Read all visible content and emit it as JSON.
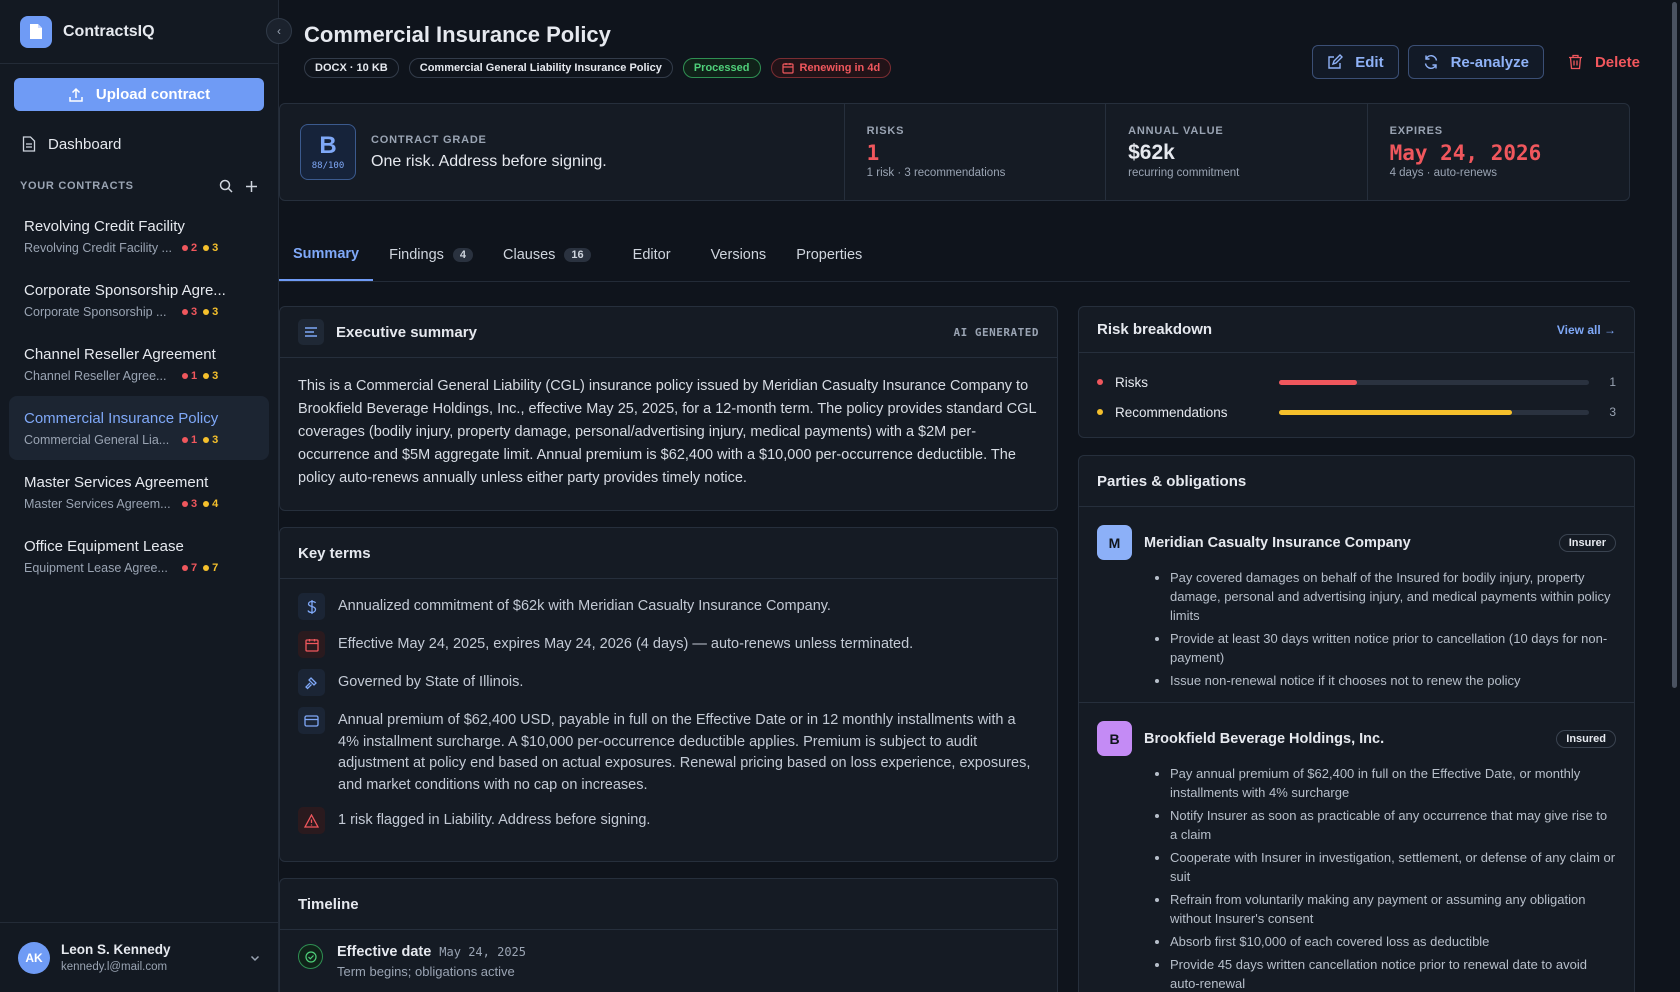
{
  "app": {
    "name": "ContractsIQ",
    "upload_label": "Upload contract",
    "dashboard_label": "Dashboard"
  },
  "sidebar": {
    "section_title": "YOUR CONTRACTS",
    "contracts": [
      {
        "title": "Revolving Credit Facility",
        "subtitle": "Revolving Credit Facility ...",
        "risks": "2",
        "recs": "3"
      },
      {
        "title": "Corporate Sponsorship Agre...",
        "subtitle": "Corporate Sponsorship ...",
        "risks": "3",
        "recs": "3"
      },
      {
        "title": "Channel Reseller Agreement",
        "subtitle": "Channel Reseller Agree...",
        "risks": "1",
        "recs": "3"
      },
      {
        "title": "Commercial Insurance Policy",
        "subtitle": "Commercial General Lia...",
        "risks": "1",
        "recs": "3"
      },
      {
        "title": "Master Services Agreement",
        "subtitle": "Master Services Agreem...",
        "risks": "3",
        "recs": "4"
      },
      {
        "title": "Office Equipment Lease",
        "subtitle": "Equipment Lease Agree...",
        "risks": "7",
        "recs": "7"
      }
    ]
  },
  "user": {
    "initials": "AK",
    "name": "Leon S. Kennedy",
    "email": "kennedy.l@mail.com"
  },
  "header": {
    "title": "Commercial Insurance Policy",
    "chips": {
      "file": "DOCX · 10 KB",
      "type": "Commercial General Liability Insurance Policy",
      "status": "Processed",
      "renewal": "Renewing in 4d"
    },
    "edit_label": "Edit",
    "reanalyze_label": "Re-analyze",
    "delete_label": "Delete"
  },
  "grade": {
    "letter": "B",
    "score": "88/100",
    "label": "CONTRACT GRADE",
    "message": "One risk. Address before signing."
  },
  "stats": [
    {
      "label": "RISKS",
      "value": "1",
      "sub": "1 risk · 3 recommendations"
    },
    {
      "label": "ANNUAL VALUE",
      "value": "$62k",
      "sub": "recurring commitment"
    },
    {
      "label": "EXPIRES",
      "value": "May 24, 2026",
      "sub": "4 days · auto-renews"
    }
  ],
  "tabs": [
    {
      "label": "Summary"
    },
    {
      "label": "Findings",
      "badge": "4"
    },
    {
      "label": "Clauses",
      "badge": "16"
    },
    {
      "label": "Editor"
    },
    {
      "label": "Versions"
    },
    {
      "label": "Properties"
    }
  ],
  "exec_summary": {
    "title": "Executive summary",
    "tag": "AI GENERATED",
    "text": "This is a Commercial General Liability (CGL) insurance policy issued by Meridian Casualty Insurance Company to Brookfield Beverage Holdings, Inc., effective May 25, 2025, for a 12-month term. The policy provides standard CGL coverages (bodily injury, property damage, personal/advertising injury, medical payments) with a $2M per-occurrence and $5M aggregate limit. Annual premium is $62,400 with a $10,000 per-occurrence deductible. The policy auto-renews annually unless either party provides timely notice."
  },
  "key_terms": {
    "title": "Key terms",
    "items": [
      {
        "icon": "dollar-icon",
        "text": "Annualized commitment of $62k with Meridian Casualty Insurance Company."
      },
      {
        "icon": "calendar-icon",
        "text": "Effective May 24, 2025, expires May 24, 2026 (4 days) — auto-renews unless terminated."
      },
      {
        "icon": "gavel-icon",
        "text": "Governed by State of Illinois."
      },
      {
        "icon": "credit-card-icon",
        "text": "Annual premium of $62,400 USD, payable in full on the Effective Date or in 12 monthly installments with a 4% installment surcharge. A $10,000 per-occurrence deductible applies. Premium is subject to audit adjustment at policy end based on actual exposures. Renewal pricing based on loss experience, exposures, and market conditions with no cap on increases."
      },
      {
        "icon": "warning-icon",
        "text": "1 risk flagged in Liability. Address before signing."
      }
    ]
  },
  "timeline": {
    "title": "Timeline",
    "items": [
      {
        "title": "Effective date",
        "date": "May 24, 2025",
        "sub": "Term begins; obligations active"
      }
    ]
  },
  "risk_breakdown": {
    "title": "Risk breakdown",
    "view_all": "View all →",
    "rows": [
      {
        "label": "Risks",
        "count": "1",
        "fraction": 0.25,
        "color": "#f0575d"
      },
      {
        "label": "Recommendations",
        "count": "3",
        "fraction": 0.75,
        "color": "#f5c02c"
      }
    ]
  },
  "parties": {
    "title": "Parties & obligations",
    "items": [
      {
        "initial": "M",
        "name": "Meridian Casualty Insurance Company",
        "role": "Insurer",
        "color": "#8cb0f8",
        "obligations": [
          "Pay covered damages on behalf of the Insured for bodily injury, property damage, personal and advertising injury, and medical payments within policy limits",
          "Provide at least 30 days written notice prior to cancellation (10 days for non-payment)",
          "Issue non-renewal notice if it chooses not to renew the policy"
        ]
      },
      {
        "initial": "B",
        "name": "Brookfield Beverage Holdings, Inc.",
        "role": "Insured",
        "color": "#c48bf5",
        "obligations": [
          "Pay annual premium of $62,400 in full on the Effective Date, or monthly installments with 4% surcharge",
          "Notify Insurer as soon as practicable of any occurrence that may give rise to a claim",
          "Cooperate with Insurer in investigation, settlement, or defense of any claim or suit",
          "Refrain from voluntarily making any payment or assuming any obligation without Insurer's consent",
          "Absorb first $10,000 of each covered loss as deductible",
          "Provide 45 days written cancellation notice prior to renewal date to avoid auto-renewal"
        ]
      }
    ]
  }
}
